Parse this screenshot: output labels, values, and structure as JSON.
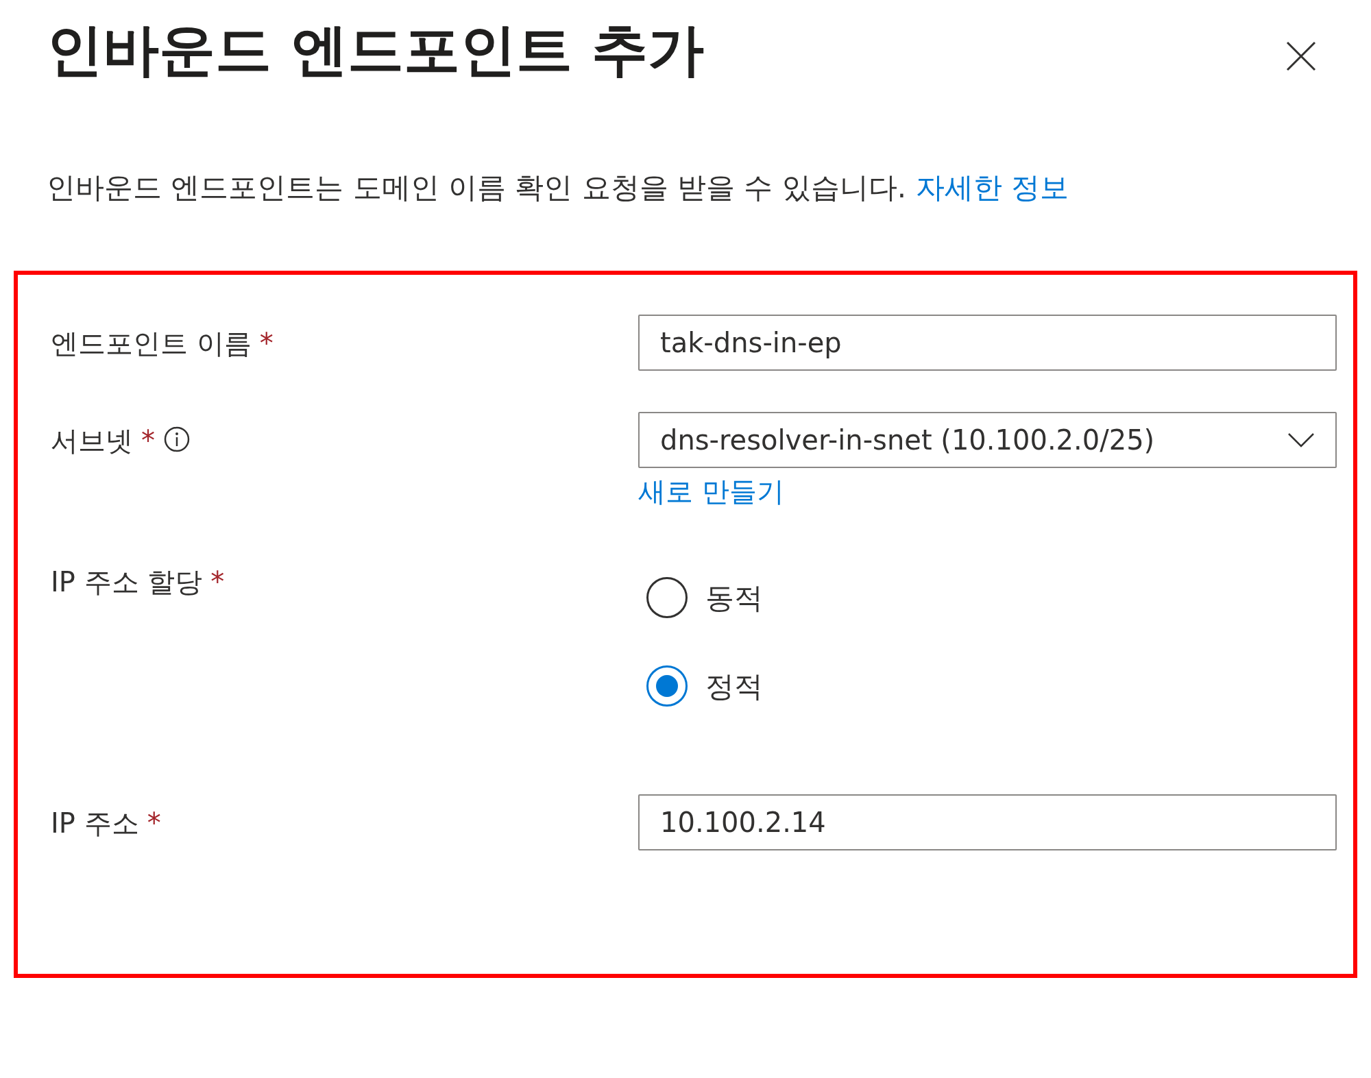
{
  "panel": {
    "title": "인바운드 엔드포인트 추가",
    "description": "인바운드 엔드포인트는 도메인 이름 확인 요청을 받을 수 있습니다.",
    "learn_more_link": "자세한 정보"
  },
  "form": {
    "highlighted": true,
    "fields": [
      {
        "kind": "text",
        "label": "엔드포인트 이름",
        "required_mark": "*",
        "info": false,
        "value": "tak-dns-in-ep"
      },
      {
        "kind": "select",
        "label": "서브넷",
        "required_mark": "*",
        "info": true,
        "value": "dns-resolver-in-snet (10.100.2.0/25)",
        "create_link": "새로 만들기"
      },
      {
        "kind": "radio",
        "label": "IP 주소 할당",
        "required_mark": "*",
        "info": false,
        "options": [
          {
            "label": "동적",
            "selected": false
          },
          {
            "label": "정적",
            "selected": true
          }
        ]
      },
      {
        "kind": "text",
        "label": "IP 주소",
        "required_mark": "*",
        "info": false,
        "value": "10.100.2.14"
      }
    ]
  }
}
